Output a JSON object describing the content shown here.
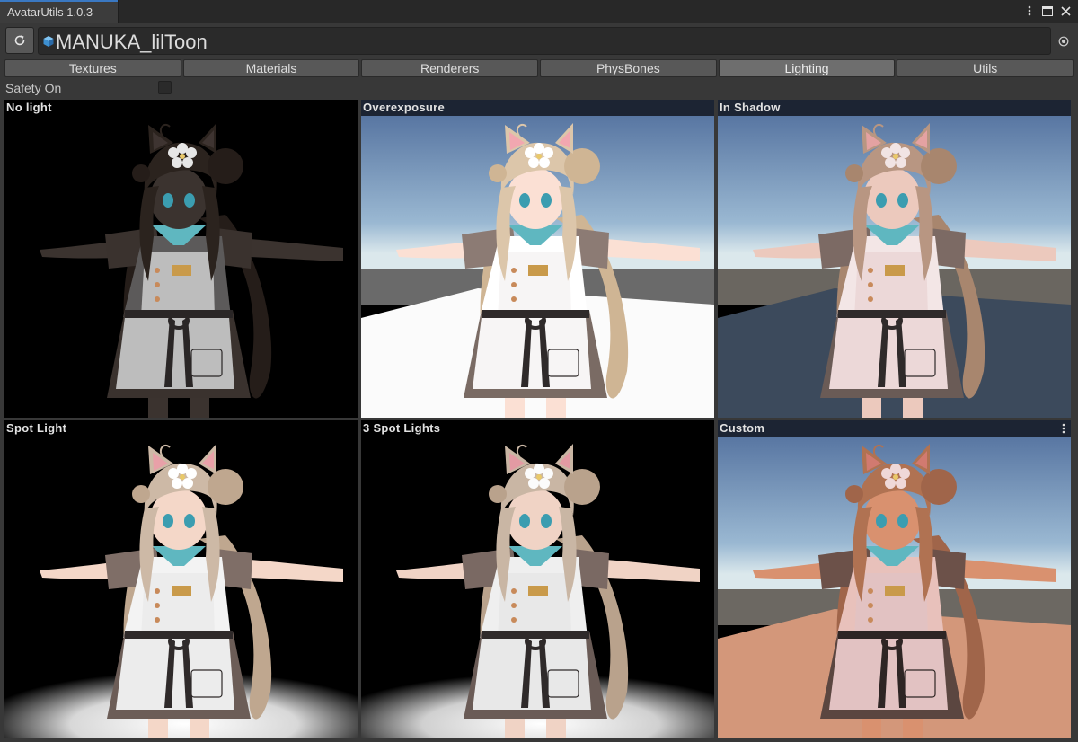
{
  "window": {
    "title": "AvatarUtils 1.0.3"
  },
  "header": {
    "object_name": "MANUKA_lilToon",
    "refresh_icon": "refresh-icon",
    "object_icon": "prefab-cube-icon",
    "picker_icon": "object-picker-icon"
  },
  "tabs": [
    {
      "label": "Textures",
      "active": false
    },
    {
      "label": "Materials",
      "active": false
    },
    {
      "label": "Renderers",
      "active": false
    },
    {
      "label": "PhysBones",
      "active": false
    },
    {
      "label": "Lighting",
      "active": true
    },
    {
      "label": "Utils",
      "active": false
    }
  ],
  "safety": {
    "label": "Safety On",
    "checked": false
  },
  "previews": [
    {
      "label": "No light"
    },
    {
      "label": "Overexposure"
    },
    {
      "label": "In Shadow"
    },
    {
      "label": "Spot Light"
    },
    {
      "label": "3 Spot Lights"
    },
    {
      "label": "Custom"
    }
  ],
  "colors": {
    "accent": "#3a78c2",
    "panel_bg": "#383838",
    "active_tab": "#6e6e6e"
  }
}
